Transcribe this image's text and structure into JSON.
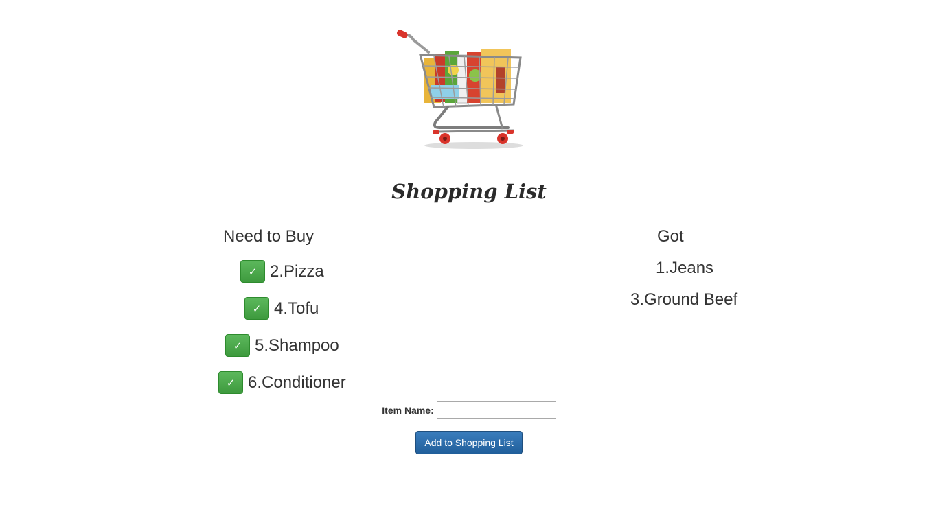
{
  "page": {
    "title": "Shopping List"
  },
  "hero": {
    "icon": "shopping-cart-icon"
  },
  "need_to_buy": {
    "heading": "Need to Buy",
    "check_glyph": "✓",
    "items": [
      {
        "label": "2.Pizza"
      },
      {
        "label": "4.Tofu"
      },
      {
        "label": "5.Shampoo"
      },
      {
        "label": "6.Conditioner"
      }
    ]
  },
  "got": {
    "heading": "Got",
    "items": [
      {
        "label": "1.Jeans"
      },
      {
        "label": "3.Ground Beef"
      }
    ]
  },
  "form": {
    "item_name_label": "Item Name:",
    "item_name_value": "",
    "item_name_placeholder": "",
    "add_button_label": "Add to Shopping List"
  },
  "colors": {
    "check_button": "#4cae4c",
    "add_button": "#286090",
    "text": "#333333"
  }
}
